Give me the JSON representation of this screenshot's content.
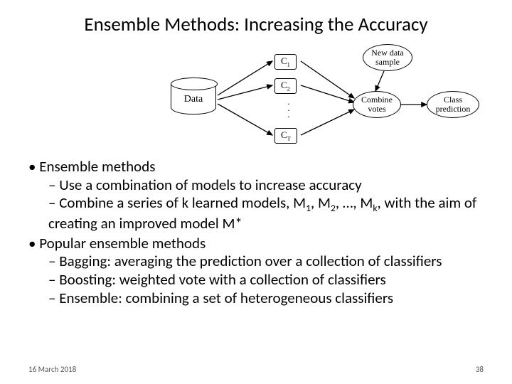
{
  "title": "Ensemble Methods: Increasing the Accuracy",
  "diagram": {
    "data_label": "Data",
    "classifiers": {
      "c1": "C",
      "c1sub": "1",
      "c2": "C",
      "c2sub": "2",
      "ct": "C",
      "ctsub": "T"
    },
    "new_sample": "New data\nsample",
    "combine": "Combine\nvotes",
    "prediction": "Class\nprediction"
  },
  "bullets": {
    "b1": "Ensemble methods",
    "b1a": "Use a combination of models to increase accuracy",
    "b1b_pre": "Combine a series of k learned models, M",
    "b1b_s1": "1",
    "b1b_mid1": ", M",
    "b1b_s2": "2",
    "b1b_mid2": ", …, M",
    "b1b_s3": "k",
    "b1b_post": ", with the aim of creating an improved model M*",
    "b2": "Popular ensemble methods",
    "b2a": "Bagging: averaging the prediction over a collection of classifiers",
    "b2b": "Boosting: weighted vote with a collection of classifiers",
    "b2c": "Ensemble: combining a set of heterogeneous classifiers"
  },
  "footer": {
    "date": "16 March 2018",
    "page": "38"
  }
}
